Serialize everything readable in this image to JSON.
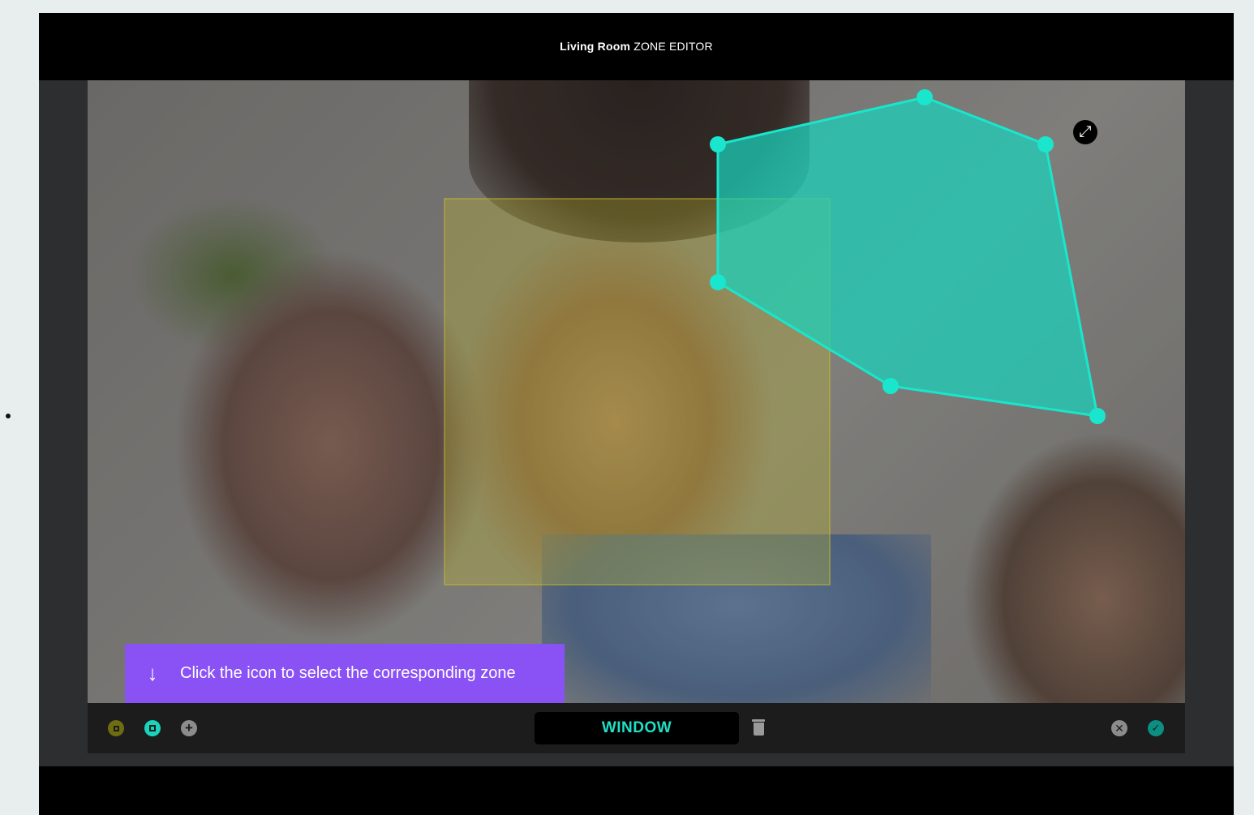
{
  "window": {
    "title_strong": "Living Room",
    "title_rest": "ZONE EDITOR"
  },
  "hint": {
    "arrow": "↓",
    "text": "Click the icon to select the corresponding zone"
  },
  "toolbar": {
    "add_symbol": "+",
    "zone_name": "WINDOW",
    "cancel_symbol": "✕",
    "confirm_symbol": "✓"
  },
  "expand_symbol": "⤢",
  "colors": {
    "accent_teal": "#19d3bd",
    "zone_yellow": "#6f6c12",
    "hint_purple": "#8a52f5"
  },
  "icons": [
    "expand-icon",
    "zone-yellow-icon",
    "zone-teal-icon",
    "add-icon",
    "trash-icon",
    "close-icon",
    "check-icon",
    "arrow-down-icon"
  ]
}
